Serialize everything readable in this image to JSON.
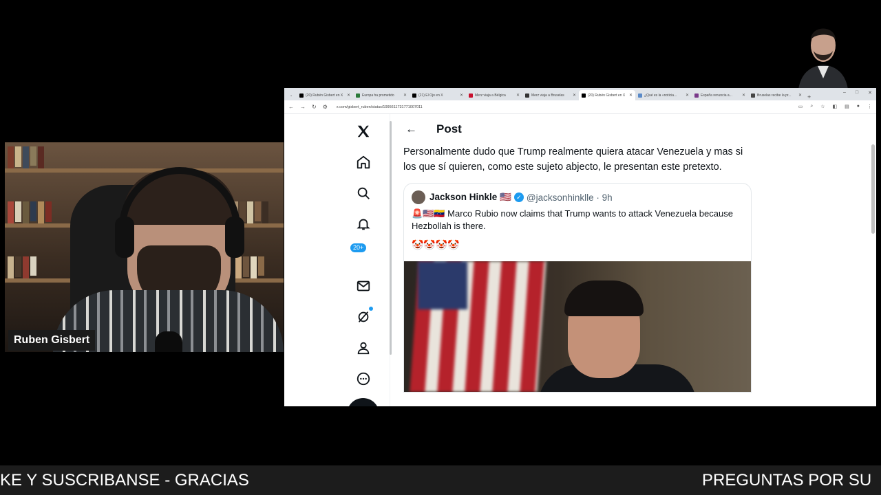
{
  "webcam": {
    "name": "Ruben Gisbert"
  },
  "browser": {
    "tabs": [
      {
        "label": "(20) Rubén Gisbert en X"
      },
      {
        "label": "Europa ha prometido"
      },
      {
        "label": "(21) El Ojo en X"
      },
      {
        "label": "Merz viaja a Bélgica"
      },
      {
        "label": "Merz viaja a Bruselas"
      },
      {
        "label": "(20) Rubén Gisbert en X",
        "active": true
      },
      {
        "label": "¿Qué es la «noticia..."
      },
      {
        "label": "España renuncia a..."
      },
      {
        "label": "Bruselas recibe la pr..."
      }
    ],
    "new_tab": "+",
    "url": "x.com/gisbert_ruben/status/1995611731771007011",
    "window_controls": [
      "–",
      "□",
      "✕"
    ]
  },
  "x": {
    "notifications_badge": "20+",
    "post_header": "Post",
    "back": "←",
    "post_text": "Personalmente dudo que Trump realmente quiera atacar Venezuela y mas si los que sí quieren, como este sujeto abjecto,  le presentan este pretexto.",
    "quote": {
      "author": "Jackson Hinkle 🇺🇸",
      "verified": "✓",
      "handle": "@jacksonhinklle · 9h",
      "text": "🚨🇺🇸🇻🇪 Marco Rubio now claims that Trump wants to attack Venezuela because Hezbollah is there.",
      "emojis": "🤡🤡🤡🤡"
    }
  },
  "ticker": {
    "left": "KE Y SUSCRIBANSE - GRACIAS",
    "right": "PREGUNTAS POR SU"
  }
}
